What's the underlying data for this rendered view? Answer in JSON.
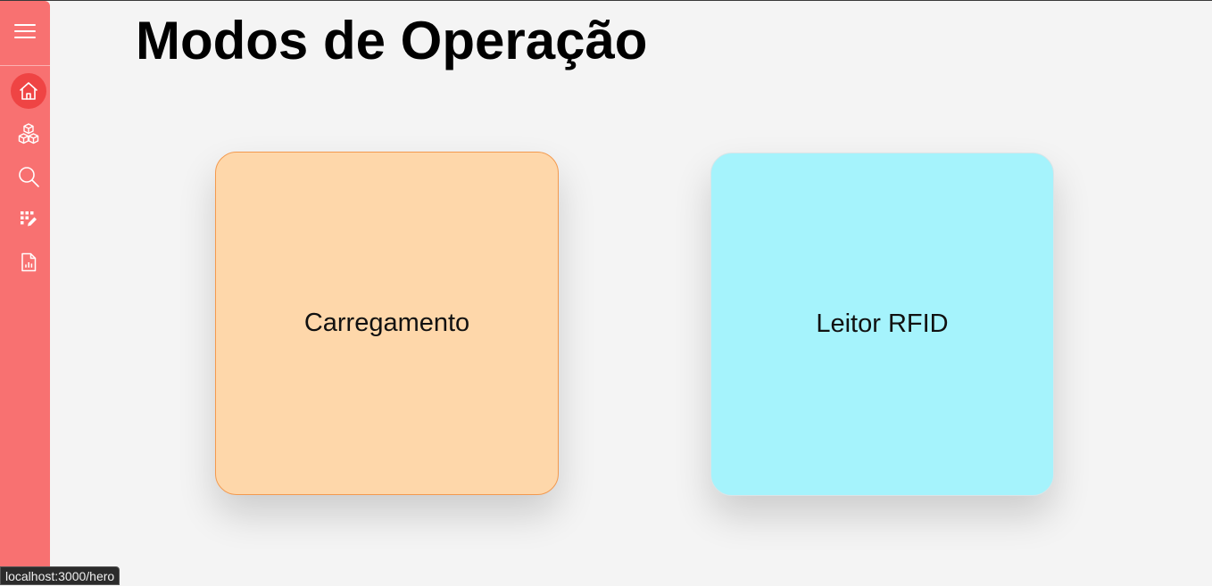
{
  "page": {
    "title": "Modos de Operação"
  },
  "sidebar": {
    "items": [
      {
        "icon": "home-icon",
        "active": true
      },
      {
        "icon": "cubes-icon",
        "active": false
      },
      {
        "icon": "search-icon",
        "active": false
      },
      {
        "icon": "grid-edit-icon",
        "active": false
      },
      {
        "icon": "report-icon",
        "active": false
      }
    ]
  },
  "cards": [
    {
      "label": "Carregamento",
      "color": "#fed7aa",
      "border": "#f39a4f"
    },
    {
      "label": "Leitor RFID",
      "color": "#a5f3fc"
    }
  ],
  "status_bar": {
    "url": "localhost:3000/hero"
  },
  "colors": {
    "sidebar": "#f87171",
    "sidebar_active": "#ef4444",
    "background": "#f4f4f4"
  }
}
